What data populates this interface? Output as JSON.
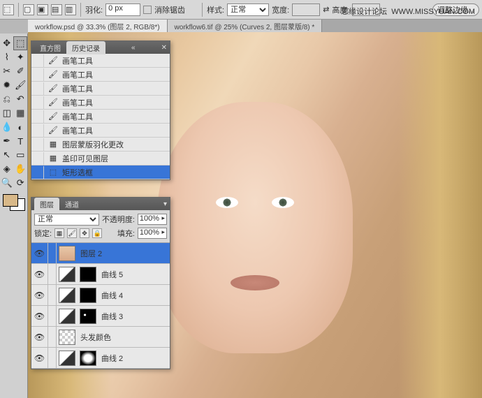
{
  "watermark": {
    "site": "思缘设计论坛",
    "url": "WWW.MISSYUAN.COM"
  },
  "options_bar": {
    "feather_label": "羽化:",
    "feather_value": "0 px",
    "antialias": "消除锯齿",
    "style_label": "样式:",
    "style_value": "正常",
    "width_label": "宽度:",
    "height_label": "高度:",
    "refine_btn": "调整边缘..."
  },
  "tabs": [
    {
      "label": "workflow.psd @ 33.3% (图层 2, RGB/8*)",
      "active": true
    },
    {
      "label": "workflow6.tif @ 25% (Curves 2, 图层蒙版/8) *",
      "active": false
    }
  ],
  "history_panel": {
    "tab_histogram": "直方图",
    "tab_history": "历史记录",
    "items": [
      {
        "icon": "🖌",
        "label": "画笔工具"
      },
      {
        "icon": "🖌",
        "label": "画笔工具"
      },
      {
        "icon": "🖌",
        "label": "画笔工具"
      },
      {
        "icon": "🖌",
        "label": "画笔工具"
      },
      {
        "icon": "🖌",
        "label": "画笔工具"
      },
      {
        "icon": "🖌",
        "label": "画笔工具"
      },
      {
        "icon": "▦",
        "label": "图层蒙版羽化更改"
      },
      {
        "icon": "▦",
        "label": "盖印可见图层"
      },
      {
        "icon": "⬚",
        "label": "矩形选框",
        "selected": true
      }
    ]
  },
  "layers_panel": {
    "tab_layers": "图层",
    "tab_channels": "通道",
    "blend_mode": "正常",
    "opacity_label": "不透明度:",
    "opacity_value": "100%",
    "lock_label": "锁定:",
    "fill_label": "填充:",
    "fill_value": "100%",
    "layers": [
      {
        "name": "图层 2",
        "thumb": "face",
        "selected": true
      },
      {
        "name": "曲线 5",
        "thumb": "adj",
        "mask": "black"
      },
      {
        "name": "曲线 4",
        "thumb": "adj",
        "mask": "black"
      },
      {
        "name": "曲线 3",
        "thumb": "adj",
        "mask": "shape"
      },
      {
        "name": "头发颜色",
        "thumb": "checker",
        "mask": "none"
      },
      {
        "name": "曲线 2",
        "thumb": "adj",
        "mask": "white-blob"
      }
    ]
  }
}
